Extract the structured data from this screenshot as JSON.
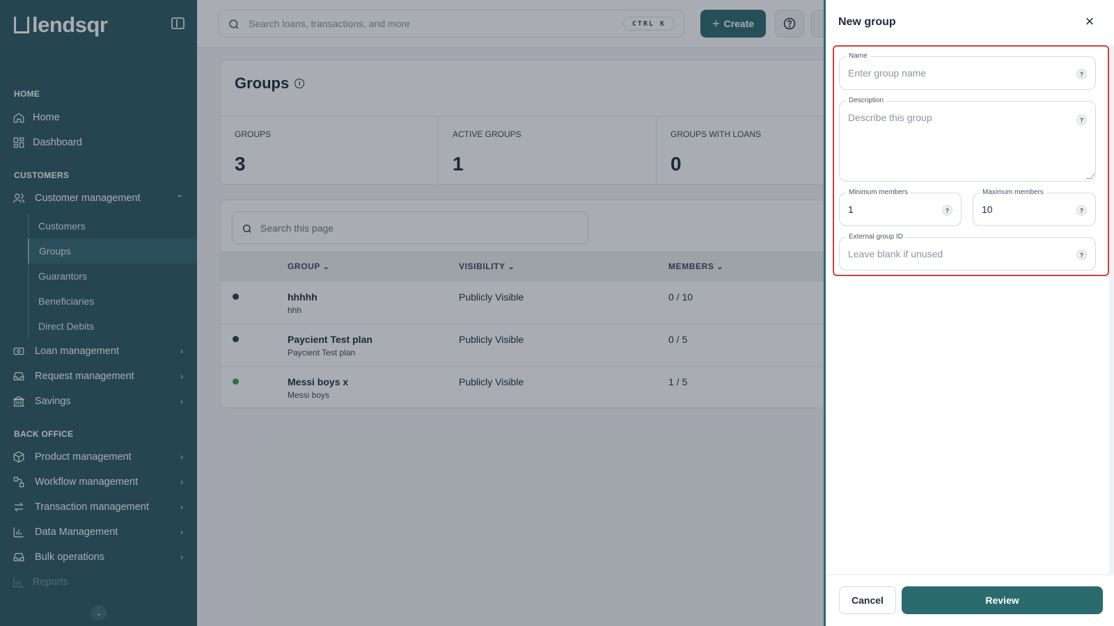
{
  "app": {
    "logo_text": "lendsqr"
  },
  "topbar": {
    "search_placeholder": "Search loans, transactions, and more",
    "shortcut": "CTRL K",
    "create_label": "Create"
  },
  "sidebar": {
    "sections": {
      "home": "HOME",
      "customers": "CUSTOMERS",
      "back_office": "BACK OFFICE"
    },
    "home_items": [
      {
        "label": "Home",
        "icon": "home-icon"
      },
      {
        "label": "Dashboard",
        "icon": "dashboard-icon"
      }
    ],
    "customer_management": {
      "label": "Customer management",
      "icon": "users-icon"
    },
    "customer_sub": [
      "Customers",
      "Groups",
      "Guarantors",
      "Beneficiaries",
      "Direct Debits"
    ],
    "customer_items": [
      {
        "label": "Loan management",
        "icon": "loan-icon"
      },
      {
        "label": "Request management",
        "icon": "inbox-icon"
      },
      {
        "label": "Savings",
        "icon": "bank-icon"
      }
    ],
    "back_office_items": [
      {
        "label": "Product management",
        "icon": "box-icon"
      },
      {
        "label": "Workflow management",
        "icon": "workflow-icon"
      },
      {
        "label": "Transaction management",
        "icon": "transfer-icon"
      },
      {
        "label": "Data Management",
        "icon": "chart-icon"
      },
      {
        "label": "Bulk operations",
        "icon": "inbox-icon"
      },
      {
        "label": "Reports",
        "icon": "chart-icon"
      }
    ]
  },
  "groups_page": {
    "title": "Groups",
    "stats": [
      {
        "label": "GROUPS",
        "value": "3"
      },
      {
        "label": "ACTIVE GROUPS",
        "value": "1"
      },
      {
        "label": "GROUPS WITH LOANS",
        "value": "0"
      }
    ],
    "search_placeholder": "Search this page",
    "columns": [
      "GROUP",
      "VISIBILITY",
      "MEMBERS"
    ],
    "rows": [
      {
        "name": "hhhhh",
        "desc": "hhh",
        "visibility": "Publicly Visible",
        "members": "0 / 10",
        "status_color": "#2e3b52"
      },
      {
        "name": "Paycient Test plan",
        "desc": "Paycient Test plan",
        "visibility": "Publicly Visible",
        "members": "0 / 5",
        "status_color": "#2e3b52"
      },
      {
        "name": "Messi boys x",
        "desc": "Messi boys",
        "visibility": "Publicly Visible",
        "members": "1 / 5",
        "status_color": "#2fa84f"
      }
    ]
  },
  "drawer": {
    "title": "New group",
    "fields": {
      "name": {
        "label": "Name",
        "placeholder": "Enter group name"
      },
      "description": {
        "label": "Description",
        "placeholder": "Describe this group"
      },
      "min_members": {
        "label": "Minimum members",
        "value": "1"
      },
      "max_members": {
        "label": "Maximum members",
        "value": "10"
      },
      "external_id": {
        "label": "External group ID",
        "placeholder": "Leave blank if unused"
      }
    },
    "cancel_label": "Cancel",
    "review_label": "Review"
  },
  "colors": {
    "brand": "#2a5a63",
    "primary": "#2a6b6e",
    "highlight": "#d63c3c"
  }
}
